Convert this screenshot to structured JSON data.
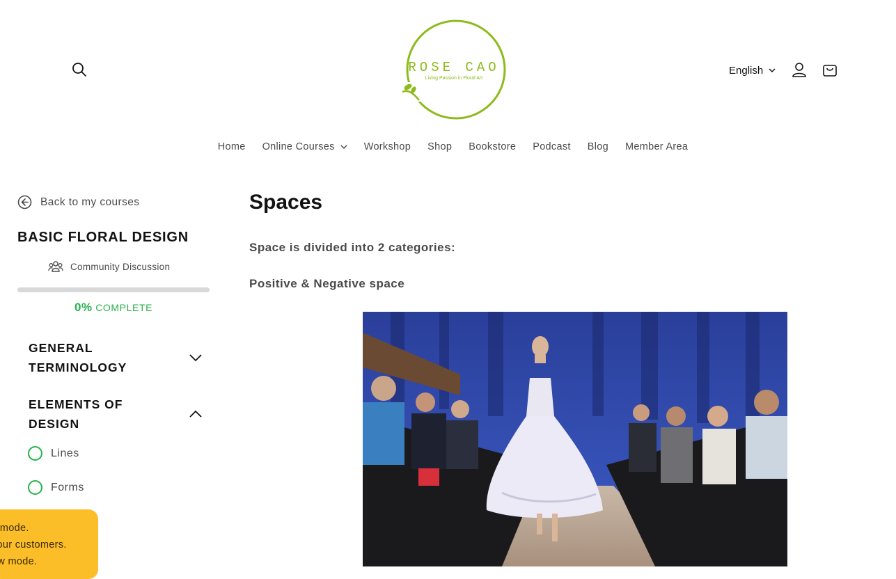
{
  "header": {
    "logo": {
      "name": "ROSE CAO",
      "tagline": "Living Passion in Floral Art"
    },
    "language": "English",
    "icons": [
      "search-icon",
      "account-icon",
      "cart-icon"
    ]
  },
  "nav": {
    "items": [
      {
        "label": "Home"
      },
      {
        "label": "Online Courses",
        "has_dropdown": true
      },
      {
        "label": "Workshop"
      },
      {
        "label": "Shop"
      },
      {
        "label": "Bookstore"
      },
      {
        "label": "Podcast"
      },
      {
        "label": "Blog"
      },
      {
        "label": "Member Area"
      }
    ]
  },
  "sidebar": {
    "back_label": "Back to my courses",
    "course_title": "BASIC FLORAL DESIGN",
    "community_label": "Community Discussion",
    "progress": {
      "percent": "0%",
      "label": "COMPLETE",
      "value": 0
    },
    "sections": [
      {
        "title": "GENERAL TERMINOLOGY",
        "expanded": false
      },
      {
        "title": "ELEMENTS OF DESIGN",
        "expanded": true,
        "lessons": [
          {
            "label": "Lines"
          },
          {
            "label": "Forms"
          }
        ]
      }
    ]
  },
  "preview_banner": {
    "lines": [
      "y mode.",
      "your customers.",
      "ew mode."
    ]
  },
  "lesson": {
    "title": "Spaces",
    "paragraphs": [
      "Space is divided into 2 categories:",
      "Positive & Negative space"
    ]
  },
  "colors": {
    "accent_green": "#27b14b",
    "logo_green": "#8cbb1a",
    "banner_yellow": "#fcbe28"
  }
}
